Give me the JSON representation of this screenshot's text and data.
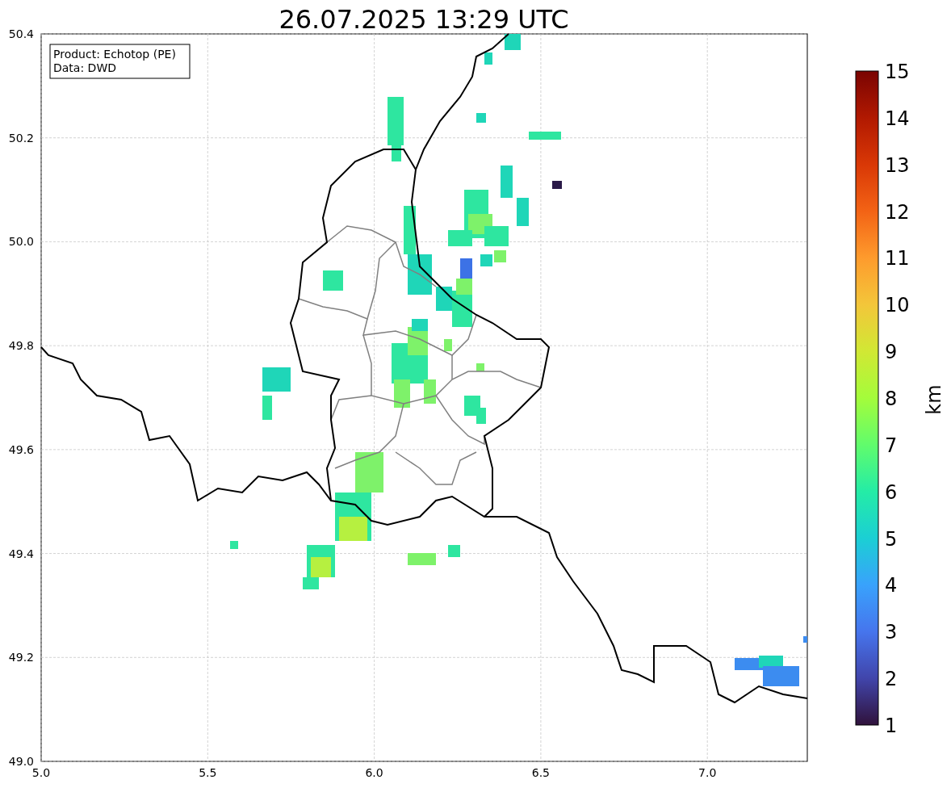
{
  "title": "26.07.2025 13:29 UTC",
  "legend": [
    "Product: Echotop (PE)",
    "Data: DWD"
  ],
  "x_ticks": [
    "5.0",
    "5.5",
    "6.0",
    "6.5",
    "7.0"
  ],
  "y_ticks": [
    "50.4",
    "50.2",
    "50.0",
    "49.8",
    "49.6",
    "49.4",
    "49.2",
    "49.0"
  ],
  "colorbar": {
    "label": "km",
    "ticks": [
      "15",
      "14",
      "13",
      "12",
      "11",
      "10",
      "9",
      "8",
      "7",
      "6",
      "5",
      "4",
      "3",
      "2",
      "1"
    ]
  }
}
